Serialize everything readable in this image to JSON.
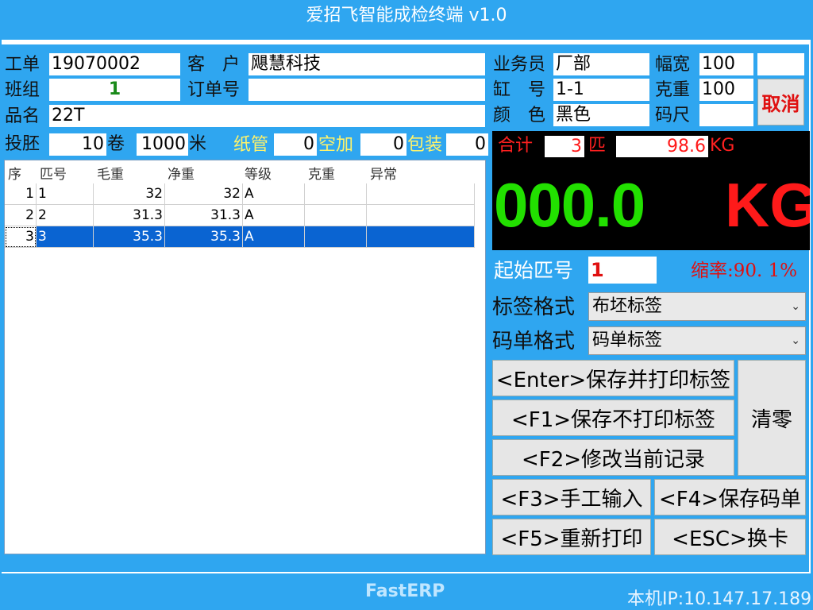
{
  "app": {
    "title": "爱招飞智能成检终端 v1.0",
    "brand": "FastERP",
    "ip": "本机IP:10.147.17.189"
  },
  "form": {
    "work_order": {
      "label": "工单",
      "value": "19070002"
    },
    "customer": {
      "label": "客　户",
      "value": "飓慧科技"
    },
    "sales": {
      "label": "业务员",
      "value": "厂部"
    },
    "width": {
      "label": "幅宽",
      "value": "100",
      "extra": ""
    },
    "team": {
      "label": "班组",
      "value": "1"
    },
    "order_no": {
      "label": "订单号",
      "value": ""
    },
    "vat": {
      "label": "缸　号",
      "value": "1-1"
    },
    "gram": {
      "label": "克重",
      "value": "100"
    },
    "product": {
      "label": "品名",
      "value": "22T"
    },
    "color": {
      "label": "颜　色",
      "value": "黑色"
    },
    "ruler": {
      "label": "码尺",
      "value": ""
    },
    "feed": {
      "label": "投胚",
      "rolls": "10",
      "rolls_unit": "卷",
      "meters": "1000",
      "meters_unit": "米"
    },
    "paper_tube": {
      "label": "纸管",
      "value": "0"
    },
    "empty": {
      "label": "空加",
      "value": "0"
    },
    "packing": {
      "label": "包装",
      "value": "0"
    }
  },
  "table": {
    "headers": [
      "序",
      "匹号",
      "毛重",
      "净重",
      "等级",
      "克重",
      "异常"
    ],
    "rows": [
      [
        "1",
        "1",
        "32",
        "32",
        "A",
        "",
        ""
      ],
      [
        "2",
        "2",
        "31.3",
        "31.3",
        "A",
        "",
        ""
      ],
      [
        "3",
        "3",
        "35.3",
        "35.3",
        "A",
        "",
        ""
      ]
    ]
  },
  "summary": {
    "total_label": "合计",
    "count": "3",
    "count_unit": "匹",
    "weight": "98.6",
    "weight_unit": "KG"
  },
  "display": {
    "value": "000.0",
    "unit": "KG"
  },
  "start": {
    "label": "起始匹号",
    "value": "1",
    "shrink": "缩率:90. 1%"
  },
  "label_format": {
    "label": "标签格式",
    "value": "布坯标签"
  },
  "code_format": {
    "label": "码单格式",
    "value": "码单标签"
  },
  "buttons": {
    "cancel": "取消",
    "enter_save_print": "<Enter>保存并打印标签",
    "f1": "<F1>保存不打印标签",
    "f2": "<F2>修改当前记录",
    "clear": "清零",
    "f3": "<F3>手工输入",
    "f4": "<F4>保存码单",
    "f5": "<F5>重新打印",
    "esc": "<ESC>换卡"
  },
  "colors": {
    "accent": "#2fa6f0",
    "display_green": "#22e000",
    "display_red": "#ff1a1a",
    "selection": "#0a64d2"
  }
}
